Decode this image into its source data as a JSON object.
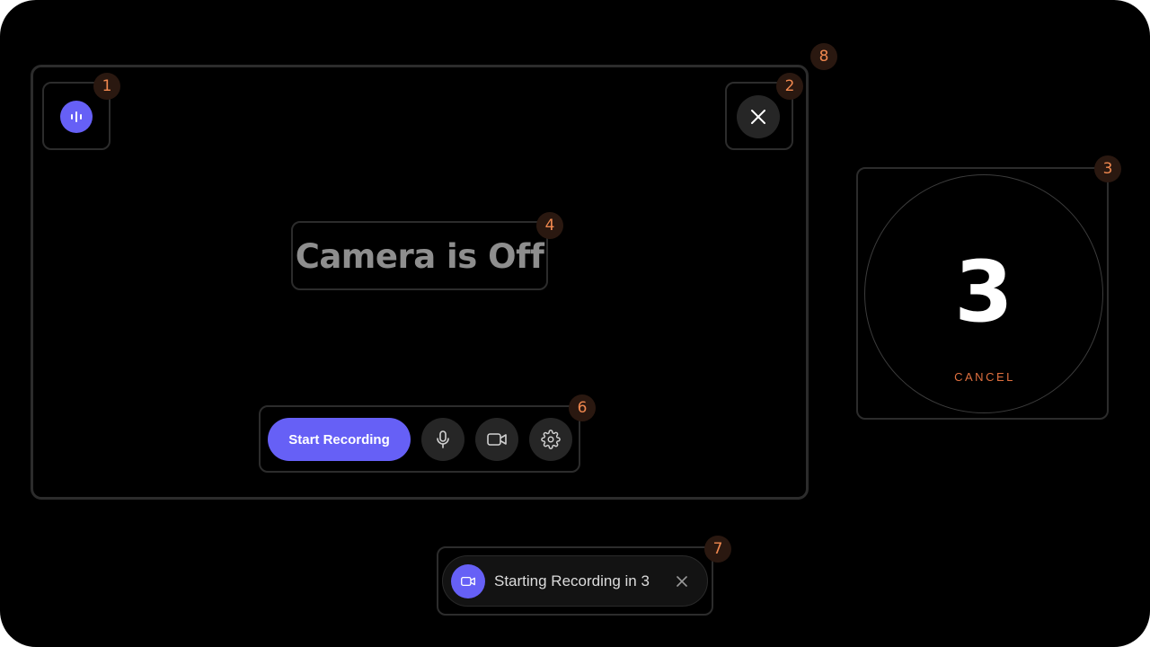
{
  "badges": {
    "b1": "1",
    "b2": "2",
    "b3": "3",
    "b4": "4",
    "b6": "6",
    "b7": "7",
    "b8": "8"
  },
  "camera": {
    "status_text": "Camera is Off"
  },
  "toolbar": {
    "start_label": "Start Recording",
    "icons": [
      "microphone-icon",
      "video-camera-icon",
      "settings-gear-icon"
    ]
  },
  "countdown": {
    "number": "3",
    "cancel_label": "CANCEL"
  },
  "toast": {
    "message": "Starting Recording in 3"
  },
  "colors": {
    "background": "#000000",
    "accent": "#6660f6",
    "badge_text": "#f0884f",
    "cancel_text": "#e0703f",
    "frame_border": "#2c2c2c",
    "button_gray": "#262626"
  }
}
